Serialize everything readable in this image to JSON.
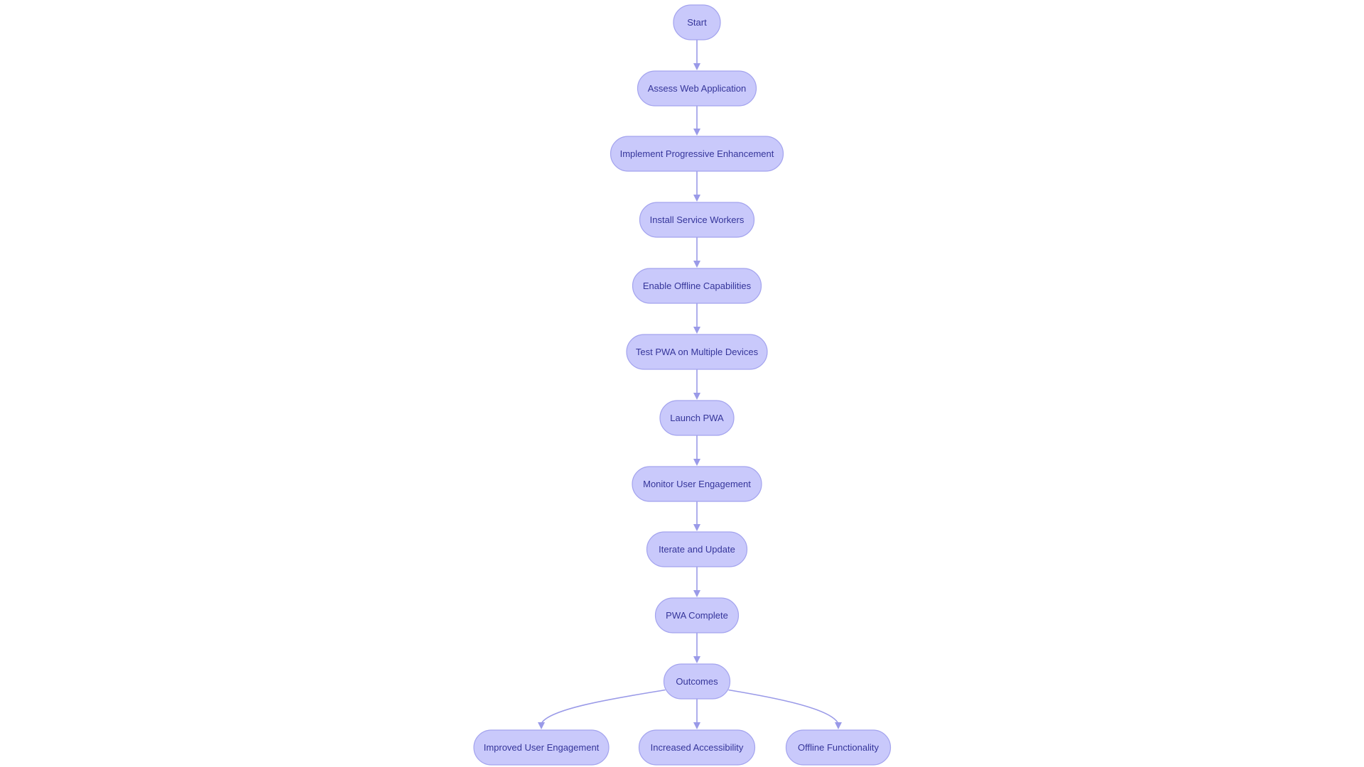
{
  "diagram": {
    "type": "flowchart",
    "direction": "top-down",
    "colors": {
      "node_fill": "#c9c9fb",
      "node_stroke": "#a3a3ee",
      "edge": "#9a9ae8",
      "text": "#35359a"
    },
    "nodes": [
      {
        "id": "start",
        "label": "Start"
      },
      {
        "id": "assess",
        "label": "Assess Web Application"
      },
      {
        "id": "implement",
        "label": "Implement Progressive Enhancement"
      },
      {
        "id": "install",
        "label": "Install Service Workers"
      },
      {
        "id": "offline_cap",
        "label": "Enable Offline Capabilities"
      },
      {
        "id": "test",
        "label": "Test PWA on Multiple Devices"
      },
      {
        "id": "launch",
        "label": "Launch PWA"
      },
      {
        "id": "monitor",
        "label": "Monitor User Engagement"
      },
      {
        "id": "iterate",
        "label": "Iterate and Update"
      },
      {
        "id": "complete",
        "label": "PWA Complete"
      },
      {
        "id": "outcomes",
        "label": "Outcomes"
      },
      {
        "id": "engagement",
        "label": "Improved User Engagement"
      },
      {
        "id": "accessibility",
        "label": "Increased Accessibility"
      },
      {
        "id": "offline_func",
        "label": "Offline Functionality"
      }
    ],
    "edges": [
      {
        "from": "start",
        "to": "assess"
      },
      {
        "from": "assess",
        "to": "implement"
      },
      {
        "from": "implement",
        "to": "install"
      },
      {
        "from": "install",
        "to": "offline_cap"
      },
      {
        "from": "offline_cap",
        "to": "test"
      },
      {
        "from": "test",
        "to": "launch"
      },
      {
        "from": "launch",
        "to": "monitor"
      },
      {
        "from": "monitor",
        "to": "iterate"
      },
      {
        "from": "iterate",
        "to": "complete"
      },
      {
        "from": "complete",
        "to": "outcomes"
      },
      {
        "from": "outcomes",
        "to": "engagement"
      },
      {
        "from": "outcomes",
        "to": "accessibility"
      },
      {
        "from": "outcomes",
        "to": "offline_func"
      }
    ]
  }
}
